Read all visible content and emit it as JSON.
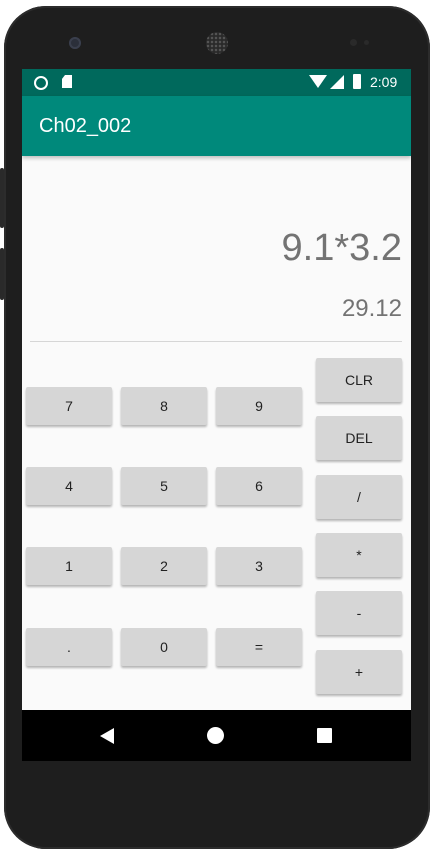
{
  "status_bar": {
    "time": "2:09",
    "icons": [
      "circle-notification-icon",
      "sd-card-icon",
      "wifi-icon",
      "cell-signal-icon",
      "battery-icon"
    ]
  },
  "app_bar": {
    "title": "Ch02_002",
    "color": "#00897b",
    "status_color": "#00695c"
  },
  "display": {
    "expression": "9.1*3.2",
    "result": "29.12"
  },
  "keypad": {
    "digits": {
      "k7": "7",
      "k8": "8",
      "k9": "9",
      "k4": "4",
      "k5": "5",
      "k6": "6",
      "k1": "1",
      "k2": "2",
      "k3": "3",
      "dot": ".",
      "k0": "0",
      "equals": "="
    },
    "ops": {
      "clr": "CLR",
      "del": "DEL",
      "divide": "/",
      "multiply": "*",
      "minus": "-",
      "plus": "+"
    }
  },
  "nav_bar": {
    "icons": [
      "back-icon",
      "home-icon",
      "recents-icon"
    ]
  }
}
